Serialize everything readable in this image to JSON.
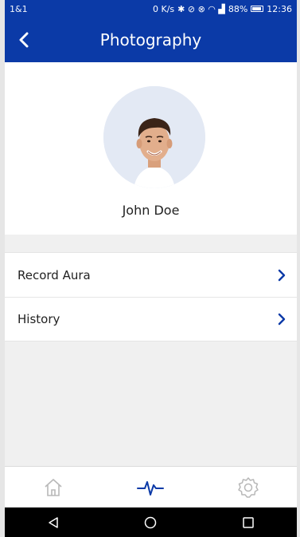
{
  "status_bar": {
    "carrier": "1&1",
    "right_text": "0 K/s",
    "battery": "88%",
    "time": "12:36"
  },
  "app_bar": {
    "title": "Photography",
    "back_icon": "chevron-left-icon"
  },
  "profile": {
    "name": "John Doe",
    "avatar_icon": "user-photo"
  },
  "menu": {
    "items": [
      {
        "label": "Record Aura",
        "icon": "chevron-right-icon"
      },
      {
        "label": "History",
        "icon": "chevron-right-icon"
      }
    ]
  },
  "tab_bar": {
    "tabs": [
      {
        "icon": "home-icon",
        "active": false
      },
      {
        "icon": "pulse-icon",
        "active": true
      },
      {
        "icon": "gear-icon",
        "active": false
      }
    ]
  },
  "colors": {
    "primary": "#0b3aa7",
    "background": "#f0f0f0",
    "inactive_icon": "#b8b8b8"
  },
  "nav_bar": {
    "buttons": [
      "back-triangle-icon",
      "home-circle-icon",
      "recents-square-icon"
    ]
  }
}
